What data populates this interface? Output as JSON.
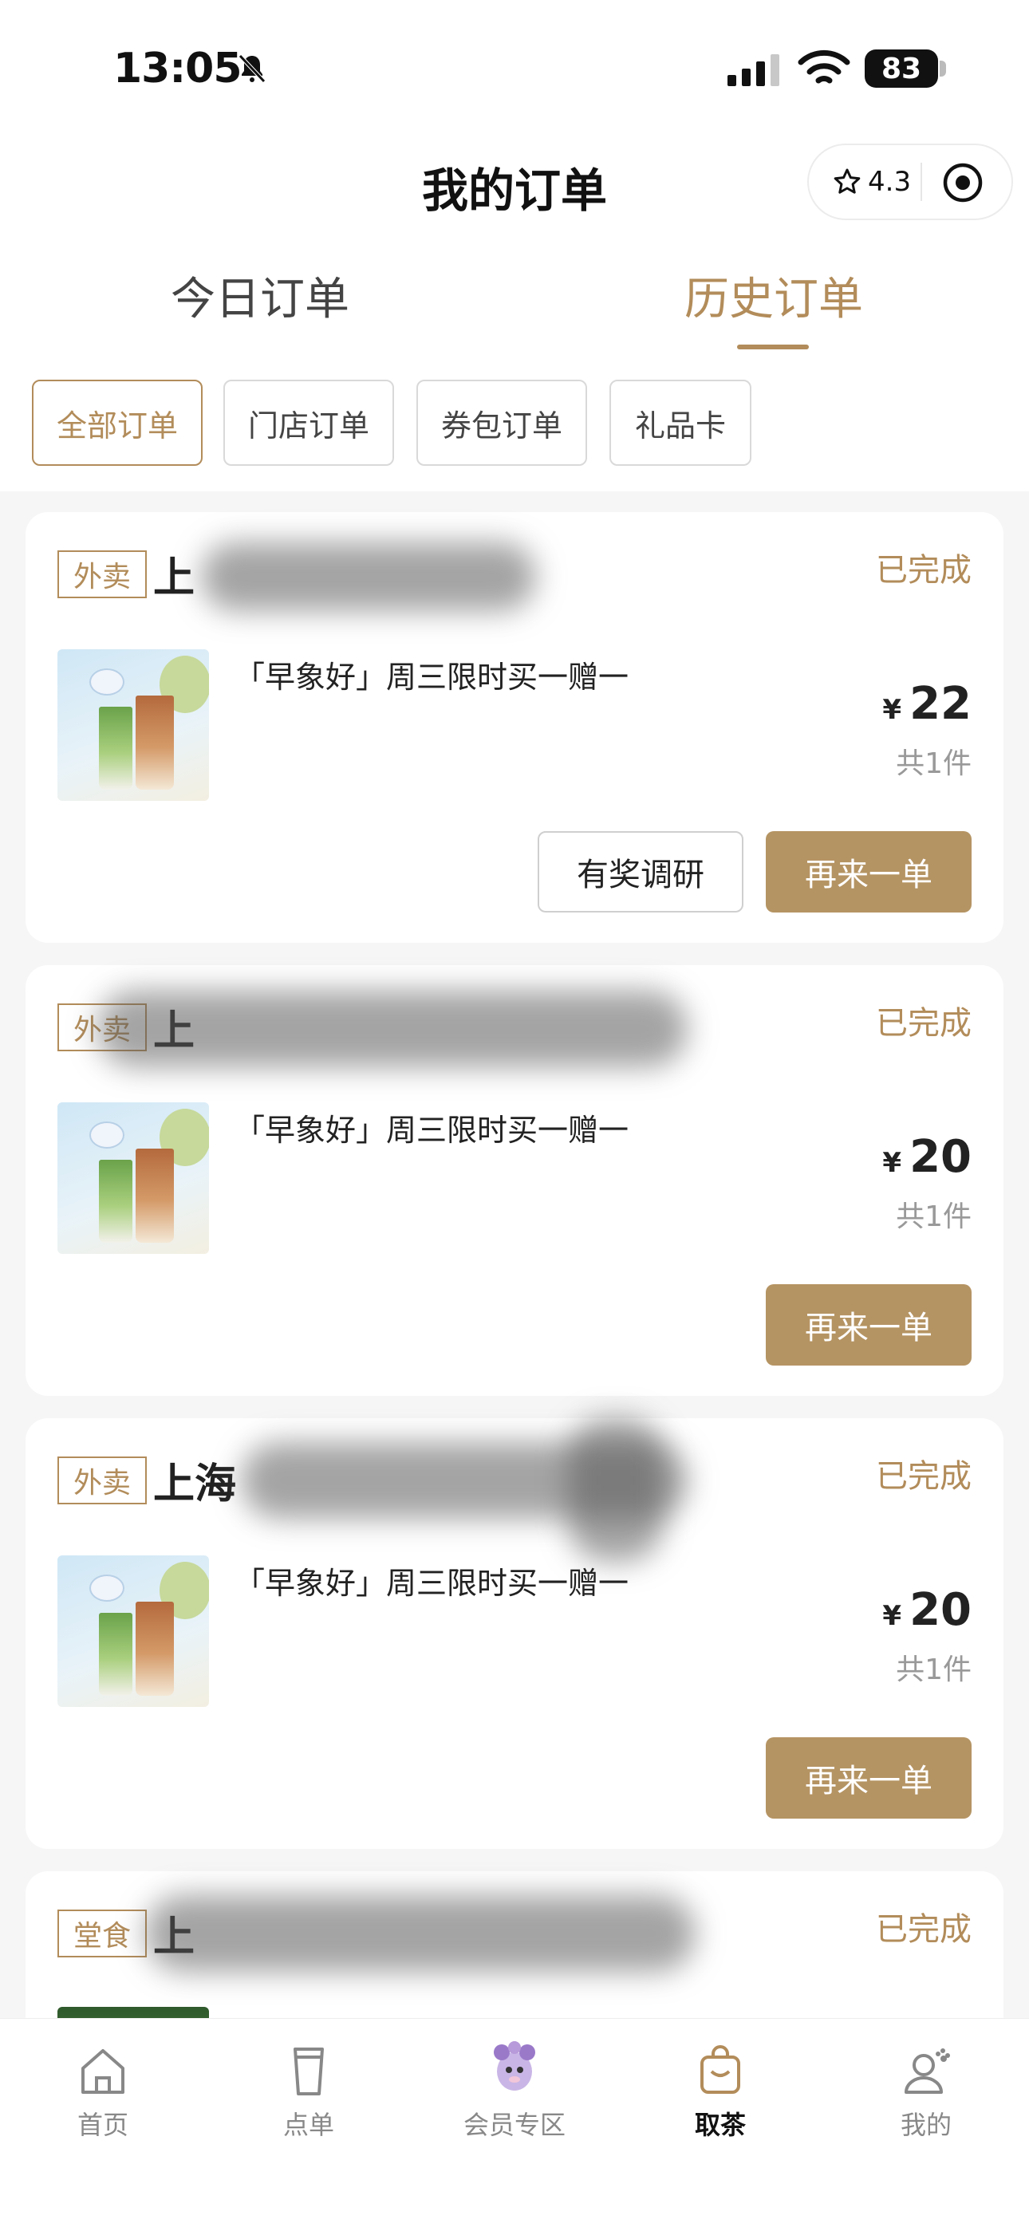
{
  "status_bar": {
    "time": "13:05",
    "battery": "83"
  },
  "header": {
    "title": "我的订单",
    "rating": "4.3"
  },
  "tabs": [
    {
      "label": "今日订单",
      "active": false
    },
    {
      "label": "历史订单",
      "active": true
    }
  ],
  "filters": [
    "全部订单",
    "门店订单",
    "券包订单",
    "礼品卡"
  ],
  "orders": [
    {
      "tag": "外卖",
      "store": "上",
      "status": "已完成",
      "item": "「早象好」周三限时买一赠一",
      "currency": "¥",
      "price": "22",
      "qty": "共1件",
      "survey_label": "有奖调研",
      "reorder_label": "再来一单"
    },
    {
      "tag": "外卖",
      "store": "上",
      "status": "已完成",
      "item": "「早象好」周三限时买一赠一",
      "currency": "¥",
      "price": "20",
      "qty": "共1件",
      "reorder_label": "再来一单"
    },
    {
      "tag": "外卖",
      "store": "上海",
      "status": "已完成",
      "item": "「早象好」周三限时买一赠一",
      "currency": "¥",
      "price": "20",
      "qty": "共1件",
      "reorder_label": "再来一单"
    },
    {
      "tag": "堂食",
      "store": "上",
      "status": "已完成"
    }
  ],
  "nav": [
    {
      "label": "首页",
      "icon": "home-icon"
    },
    {
      "label": "点单",
      "icon": "cup-icon"
    },
    {
      "label": "会员专区",
      "icon": "mascot-icon"
    },
    {
      "label": "取茶",
      "icon": "bag-icon"
    },
    {
      "label": "我的",
      "icon": "profile-icon"
    }
  ],
  "colors": {
    "accent": "#b28c5a",
    "button": "#b59463",
    "background": "#f6f6f6"
  }
}
